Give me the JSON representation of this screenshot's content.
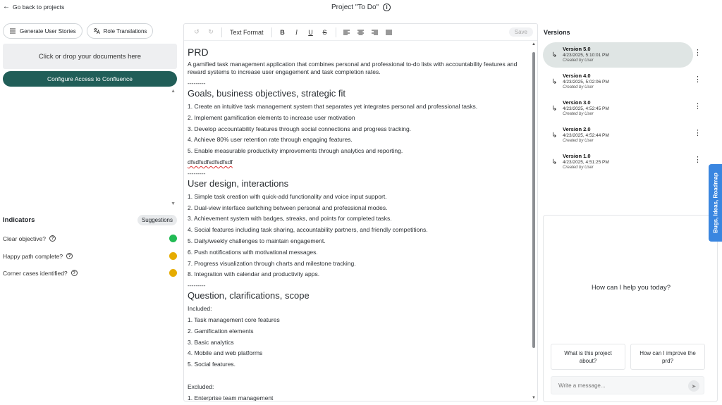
{
  "topbar": {
    "back_label": "Go back to projects",
    "project_title": "Project \"To Do\""
  },
  "left": {
    "generate_stories": "Generate User Stories",
    "role_translations": "Role Translations",
    "dropzone": "Click or drop your documents here",
    "confluence": "Configure Access to Confluence",
    "indicators": {
      "title": "Indicators",
      "suggestions": "Suggestions",
      "items": [
        {
          "label": "Clear objective?",
          "status_color": "#22bb55"
        },
        {
          "label": "Happy path complete?",
          "status_color": "#e6ac00"
        },
        {
          "label": "Corner cases identified?",
          "status_color": "#e6ac00"
        }
      ]
    }
  },
  "editor": {
    "text_format": "Text Format",
    "save": "Save",
    "doc": {
      "title": "PRD",
      "intro": "A gamified task management application that combines personal and professional to-do lists with accountability features and reward systems to increase user engagement and task completion rates.",
      "separator": "---------",
      "goals": {
        "heading": "Goals, business objectives, strategic fit",
        "items": [
          "1. Create an intuitive task management system that separates yet integrates personal and professional tasks.",
          "2. Implement gamification elements to increase user motivation",
          "3. Develop accountability features through social connections and progress tracking.",
          "4. Achieve 80% user retention rate through engaging features.",
          "5. Enable measurable productivity improvements through analytics and reporting."
        ],
        "stray": "dfsdfsdfsdfsdfsdf"
      },
      "design": {
        "heading": "User design, interactions",
        "items": [
          "1. Simple task creation with quick-add functionality and voice input support.",
          "2. Dual-view interface switching between personal and professional modes.",
          "3. Achievement system with badges, streaks, and points for completed tasks.",
          "4. Social features including task sharing, accountability partners, and friendly competitions.",
          "5. Daily/weekly challenges to maintain engagement.",
          "6. Push notifications with motivational messages.",
          "7. Progress visualization through charts and milestone tracking.",
          "8. Integration with calendar and productivity apps."
        ]
      },
      "scope": {
        "heading": "Question, clarifications, scope",
        "included_label": "Included:",
        "included": [
          "1. Task management core features",
          "2. Gamification elements",
          "3. Basic analytics",
          "4. Mobile and web platforms",
          "5. Social features."
        ],
        "excluded_label": "Excluded:",
        "excluded": [
          "1. Enterprise team management"
        ]
      }
    }
  },
  "versions": {
    "title": "Versions",
    "items": [
      {
        "name": "Version 5.0",
        "date": "4/23/2025, 5:10:01 PM",
        "by": "Created by User"
      },
      {
        "name": "Version 4.0",
        "date": "4/23/2025, 5:02:06 PM",
        "by": "Created by User"
      },
      {
        "name": "Version 3.0",
        "date": "4/23/2025, 4:52:45 PM",
        "by": "Created by User"
      },
      {
        "name": "Version 2.0",
        "date": "4/23/2025, 4:52:44 PM",
        "by": "Created by User"
      },
      {
        "name": "Version 1.0",
        "date": "4/23/2025, 4:51:25 PM",
        "by": "Created by User"
      }
    ]
  },
  "chat": {
    "prompt": "How can I help you today?",
    "suggestion_1": "What is this project about?",
    "suggestion_2": "How can I improve the prd?",
    "placeholder": "Write a message..."
  },
  "feedback_tab": "Bugs, Ideas, Roadmap",
  "colors": {
    "accent": "#215e58",
    "active_version": "#dfe5e4",
    "feedback": "#3a86e0"
  }
}
